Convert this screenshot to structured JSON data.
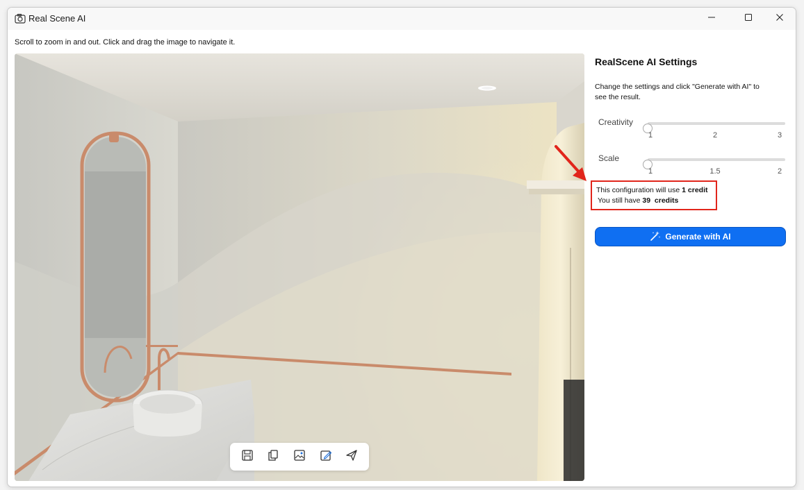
{
  "window": {
    "title": "Real Scene AI",
    "icons": {
      "app": "camera-icon",
      "minimize": "minimize-icon",
      "maximize": "maximize-icon",
      "close": "close-icon"
    }
  },
  "instructions": "Scroll to zoom in and out. Click and drag the image to navigate it.",
  "toolbar": {
    "buttons": [
      {
        "name": "save",
        "icon": "save-icon"
      },
      {
        "name": "copy",
        "icon": "copy-icon"
      },
      {
        "name": "image-settings",
        "icon": "image-settings-icon"
      },
      {
        "name": "edit-image",
        "icon": "edit-image-icon"
      },
      {
        "name": "send",
        "icon": "send-icon"
      }
    ]
  },
  "settings": {
    "title": "RealScene AI Settings",
    "description": "Change the settings and click \"Generate with AI\" to see the result.",
    "creativity": {
      "label": "Creativity",
      "ticks": [
        "1",
        "2",
        "3"
      ],
      "value": 1,
      "min": 1,
      "max": 3
    },
    "scale": {
      "label": "Scale",
      "ticks": [
        "1",
        "1.5",
        "2"
      ],
      "value": 1,
      "min": 1,
      "max": 2
    },
    "credits": {
      "usage_prefix": "This configuration will use ",
      "usage_amount": "1 credit",
      "remaining_prefix": "You still have ",
      "remaining_amount": "39  credits"
    },
    "generate_button": "Generate with AI"
  },
  "colors": {
    "accent": "#0f6ff2",
    "highlight": "#e1251b",
    "copper": "#c98b6b"
  }
}
